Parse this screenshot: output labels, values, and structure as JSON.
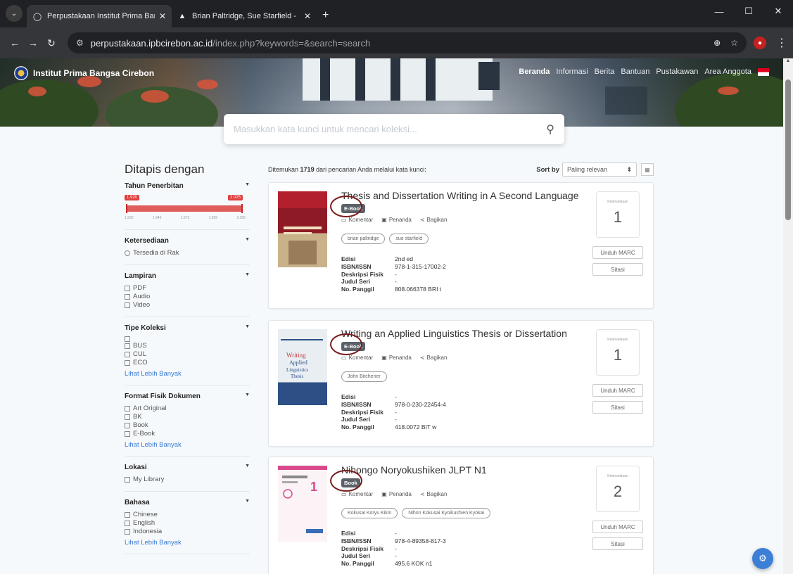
{
  "browser": {
    "tabs": [
      {
        "label": "Perpustakaan Institut Prima Bar",
        "active": true,
        "icon": "globe-icon"
      },
      {
        "label": "Brian Paltridge, Sue Starfield - ",
        "active": false,
        "icon": "drive-icon"
      }
    ],
    "url_host": "perpustakaan.ipbcirebon.ac.id",
    "url_path": "/index.php?keywords=&search=search"
  },
  "site": {
    "brand": "Institut Prima Bangsa Cirebon",
    "nav": [
      "Beranda",
      "Informasi",
      "Berita",
      "Bantuan",
      "Pustakawan",
      "Area Anggota"
    ]
  },
  "search": {
    "placeholder": "Masukkan kata kunci untuk mencari koleksi..."
  },
  "filters": {
    "title": "Ditapis dengan",
    "year": {
      "title": "Tahun Penerbitan",
      "min": "1.920",
      "max": "2.025",
      "ticks": [
        "1.920",
        "1.946",
        "1.973",
        "1.999",
        "2.025"
      ]
    },
    "availability": {
      "title": "Ketersediaan",
      "options": [
        "Tersedia di Rak"
      ]
    },
    "attachment": {
      "title": "Lampiran",
      "options": [
        "PDF",
        "Audio",
        "Video"
      ]
    },
    "collection_type": {
      "title": "Tipe Koleksi",
      "options": [
        "",
        "BUS",
        "CUL",
        "ECO"
      ],
      "more": "Lihat Lebih Banyak"
    },
    "format": {
      "title": "Format Fisik Dokumen",
      "options": [
        "Art Original",
        "BK",
        "Book",
        "E-Book"
      ],
      "more": "Lihat Lebih Banyak"
    },
    "location": {
      "title": "Lokasi",
      "options": [
        "My Library"
      ]
    },
    "language": {
      "title": "Bahasa",
      "options": [
        "Chinese",
        "English",
        "Indonesia"
      ],
      "more": "Lihat Lebih Banyak"
    }
  },
  "results": {
    "prefix": "Ditemukan",
    "count": "1719",
    "suffix": "dari pencarian Anda melalui kata kunci:",
    "sort_label": "Sort by",
    "sort_value": "Paling relevan",
    "meta_labels": {
      "edition": "Edisi",
      "isbn": "ISBN/ISSN",
      "physical": "Deskripsi Fisik",
      "series": "Judul Seri",
      "call": "No. Panggil"
    },
    "actions": {
      "comment": "Komentar",
      "bookmark": "Penanda",
      "share": "Bagikan"
    },
    "availability_label": "Ketersediaan",
    "marc_label": "Unduh MARC",
    "cite_label": "Sitasi",
    "items": [
      {
        "title": "Thesis and Dissertation Writing in A Second Language",
        "badge": "E-Book",
        "authors": [
          "brian paltridge",
          "sue starfield"
        ],
        "edition": "2nd ed",
        "isbn": "978-1-315-17002-2",
        "physical": "-",
        "series": "-",
        "call": "808.066378 BRI t",
        "available": "1"
      },
      {
        "title": "Writing an Applied Linguistics Thesis or Dissertation",
        "badge": "E-Book",
        "authors": [
          "John Bitchener"
        ],
        "edition": "-",
        "isbn": "978-0-230-22454-4",
        "physical": "-",
        "series": "-",
        "call": "418.0072 BIT w",
        "available": "1"
      },
      {
        "title": "Nihongo Noryokushiken JLPT N1",
        "badge": "Book",
        "authors": [
          "Kokusai Koryu Kikin",
          "Nihon Kokusai Kyoikushien Kyokai"
        ],
        "edition": "-",
        "isbn": "978-4-89358-817-3",
        "physical": "-",
        "series": "-",
        "call": "495.6 KOK n1",
        "available": "2"
      }
    ]
  },
  "colors": {
    "accent": "#e03e3e",
    "link": "#3a7bd5",
    "badge": "#5b6168",
    "annotation": "#7a1c1c"
  }
}
